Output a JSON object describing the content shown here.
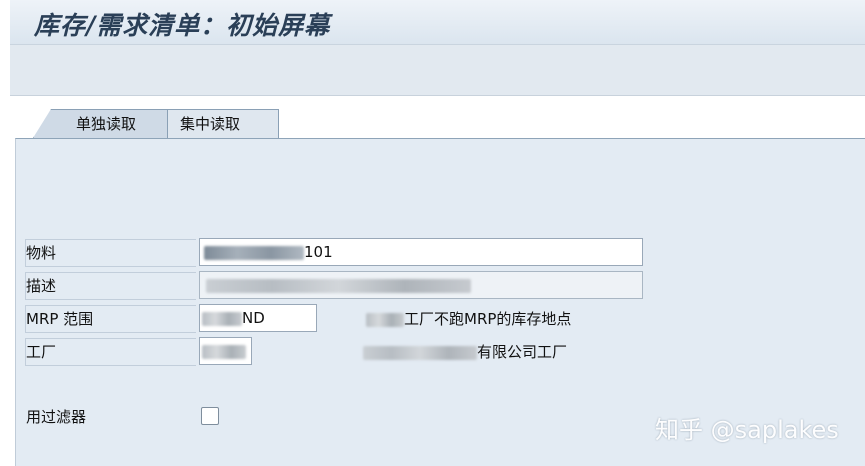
{
  "window": {
    "title": "库存/需求清单：初始屏幕"
  },
  "tabs": [
    {
      "label": "单独读取",
      "active": true
    },
    {
      "label": "集中读取",
      "active": false
    }
  ],
  "fields": {
    "material": {
      "label": "物料",
      "value": "101"
    },
    "description": {
      "label": "描述",
      "value": ""
    },
    "mrp_area": {
      "label": "MRP 范围",
      "value": "ND",
      "description": "工厂不跑MRP的库存地点"
    },
    "plant": {
      "label": "工厂",
      "value": "",
      "description": "有限公司工厂"
    },
    "filter": {
      "label": "用过滤器",
      "checked": false
    }
  },
  "watermark": "知乎 @saplakes",
  "colors": {
    "title_text": "#2a3f57",
    "panel_bg": "#e3ebf3",
    "field_border": "#99a8b8"
  }
}
